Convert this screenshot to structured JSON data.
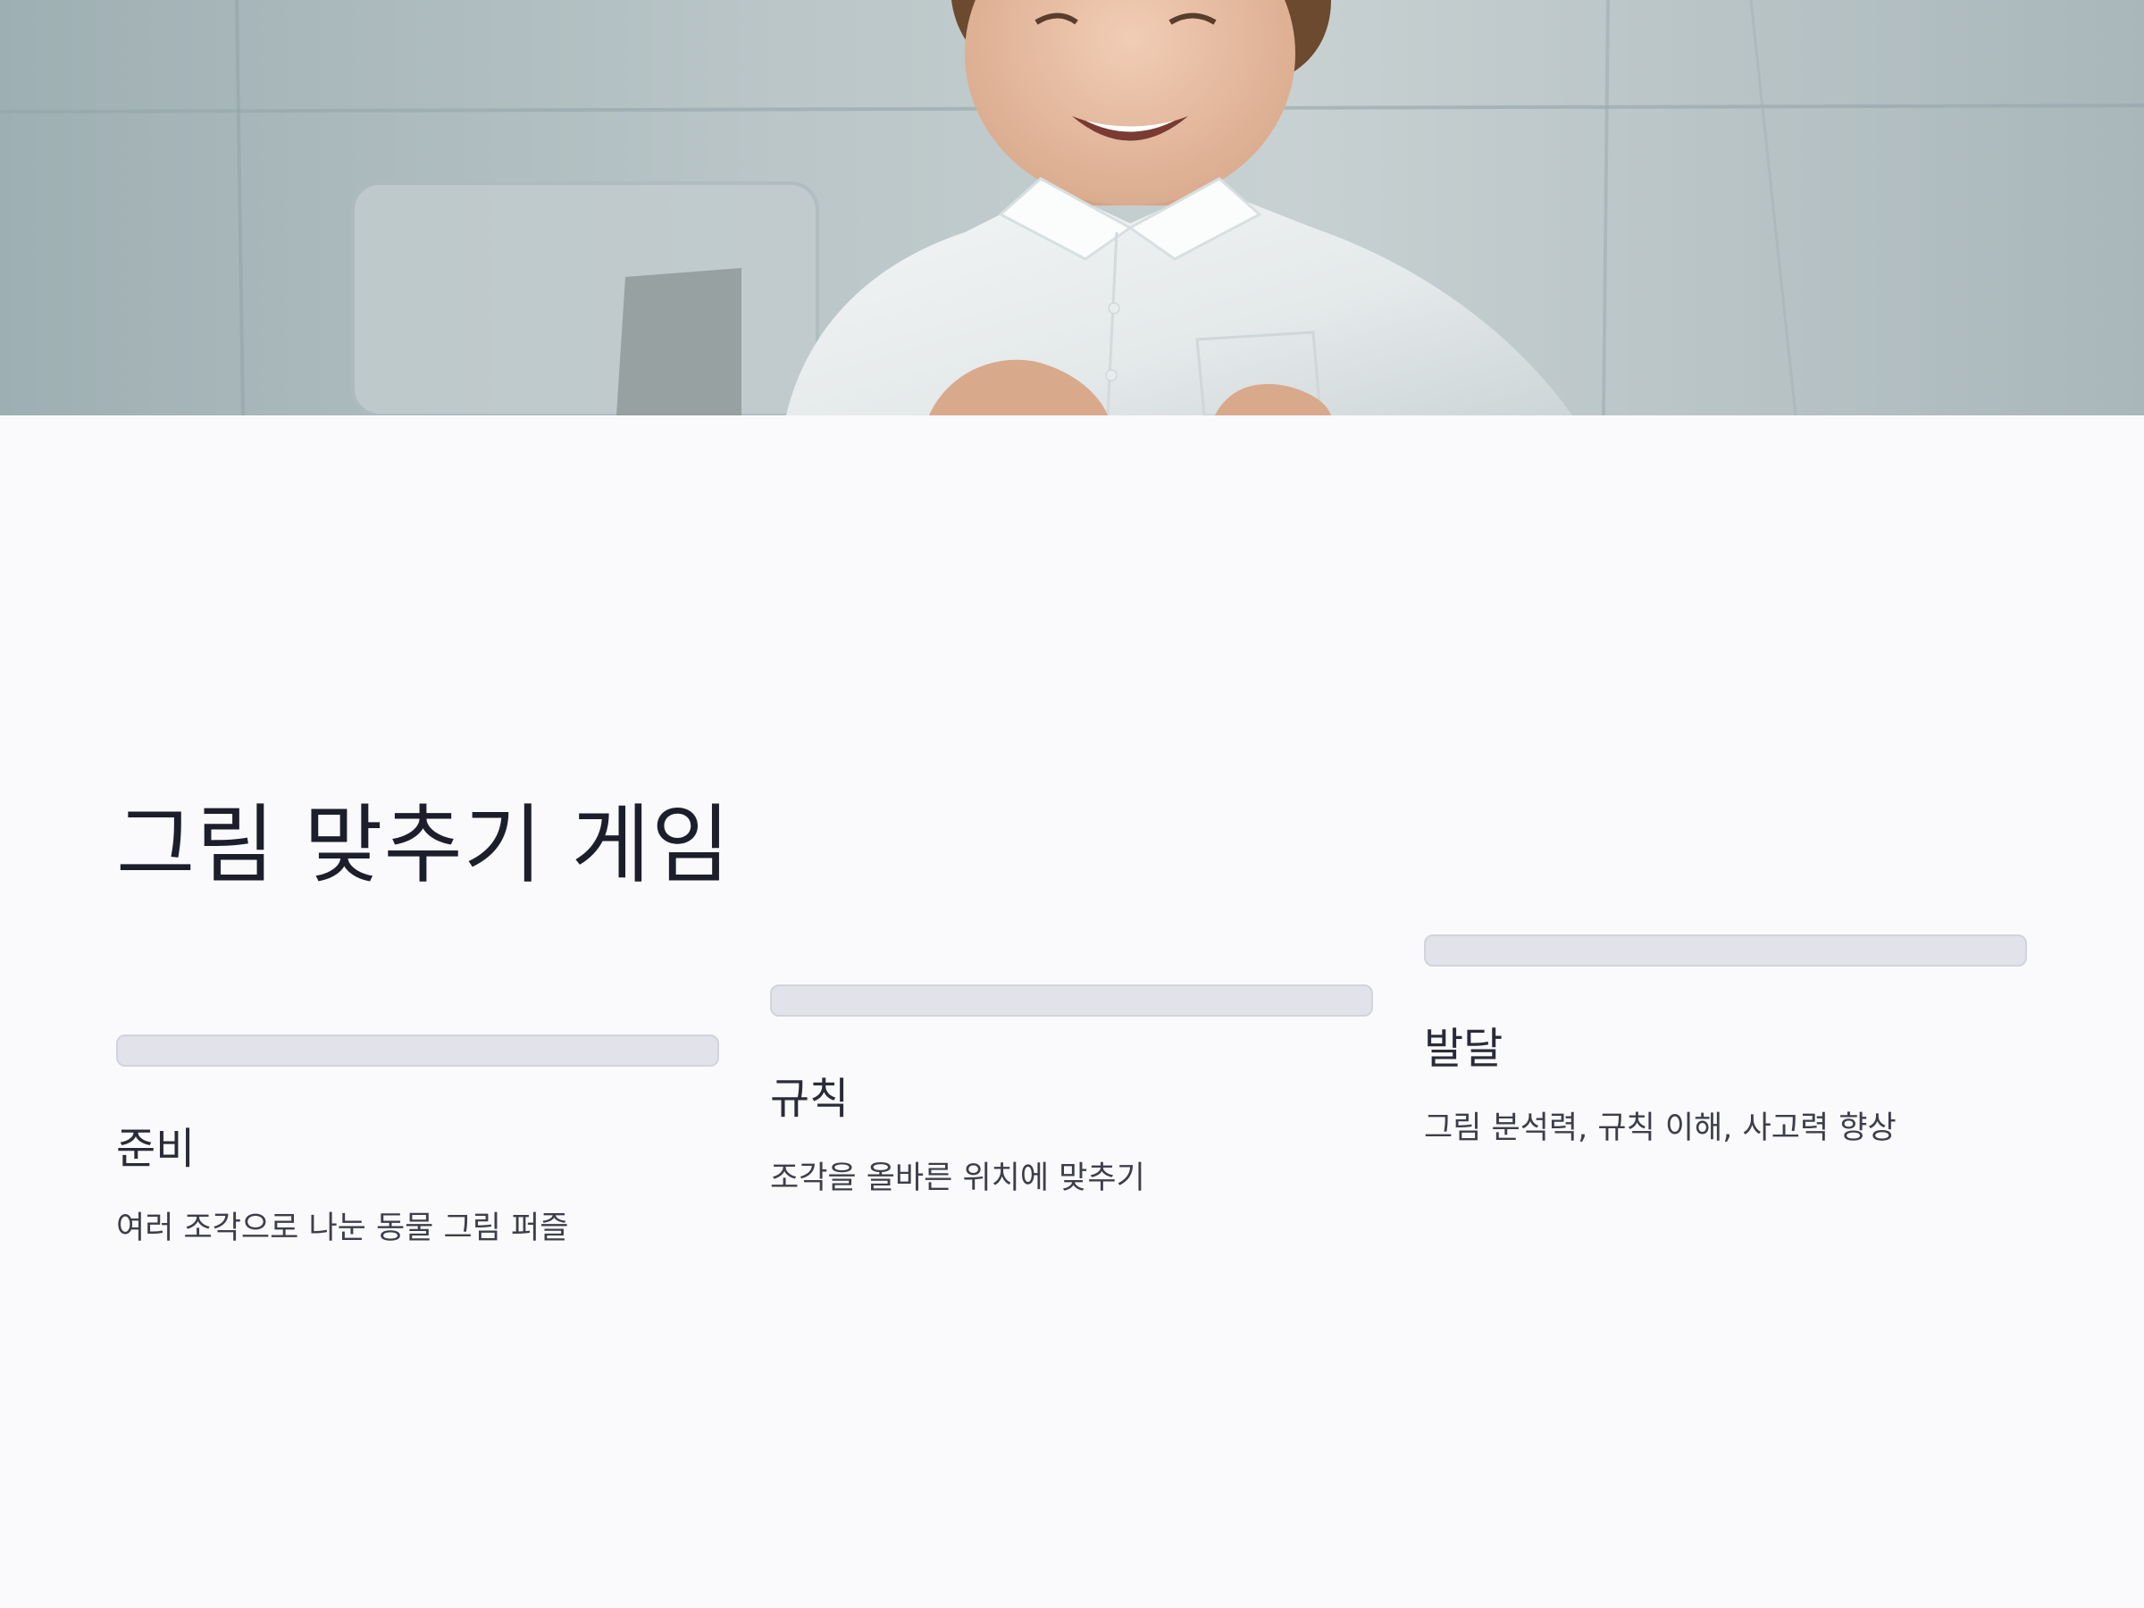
{
  "title": "그림 맞추기 게임",
  "steps": [
    {
      "title": "준비",
      "description": "여러 조각으로 나눈 동물 그림 퍼즐"
    },
    {
      "title": "규칙",
      "description": "조각을 올바른 위치에 맞추기"
    },
    {
      "title": "발달",
      "description": "그림 분석력, 규칙 이해, 사고력 향상"
    }
  ],
  "colors": {
    "background": "#fafafc",
    "bar_fill": "#e1e2ea",
    "title_text": "#1d1e2b"
  }
}
